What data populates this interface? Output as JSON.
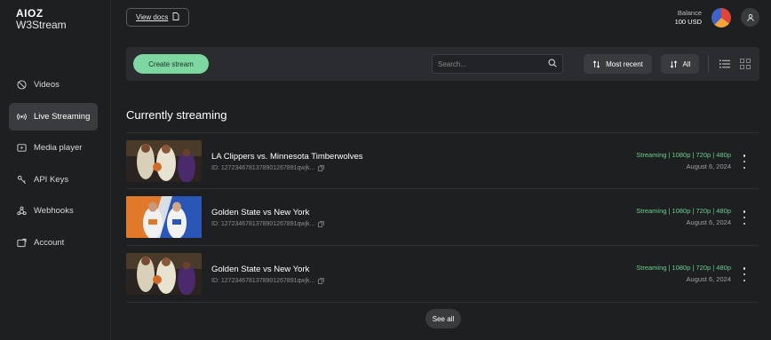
{
  "brand": {
    "top": "AIOZ",
    "bottom": "W3Stream"
  },
  "sidebar": {
    "items": [
      {
        "label": "Videos",
        "icon": "video-icon"
      },
      {
        "label": "Live Streaming",
        "icon": "broadcast-icon",
        "active": true
      },
      {
        "label": "Media player",
        "icon": "player-icon"
      },
      {
        "label": "API Keys",
        "icon": "key-icon"
      },
      {
        "label": "Webhooks",
        "icon": "webhook-icon"
      },
      {
        "label": "Account",
        "icon": "account-icon"
      }
    ]
  },
  "header": {
    "docs_label": "View docs",
    "balance_label": "Balance",
    "balance_value": "100 USD"
  },
  "toolbar": {
    "create_label": "Create stream",
    "search_placeholder": "Search...",
    "sort_label": "Most recent",
    "filter_label": "All"
  },
  "main": {
    "section_title": "Currently streaming",
    "streams": [
      {
        "title": "LA Clippers vs. Minnesota Timberwolves",
        "id": "ID: 1272346781378901267891qwjk...",
        "status": "Streaming | 1080p | 720p | 480p",
        "date": "August 6, 2024"
      },
      {
        "title": "Golden State vs New York",
        "id": "ID: 1272346781378901267891qwjk...",
        "status": "Streaming | 1080p | 720p | 480p",
        "date": "August 6, 2024"
      },
      {
        "title": "Golden State vs New York",
        "id": "ID: 1272346781378901267891qwjk...",
        "status": "Streaming | 1080p | 720p | 480p",
        "date": "August 6, 2024"
      }
    ],
    "see_all_label": "See all"
  },
  "colors": {
    "accent": "#7ed6a1",
    "status": "#6bd08e",
    "background": "#1e1f21"
  }
}
